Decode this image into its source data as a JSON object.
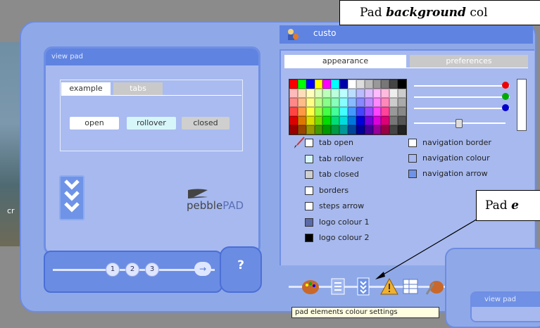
{
  "background_caption": "cr",
  "view_pad": {
    "header": "view pad",
    "tabs": [
      "example",
      "tabs"
    ],
    "buttons": {
      "open": "open",
      "rollover": "rollover",
      "closed": "closed"
    },
    "brand": {
      "part1": "pebble",
      "part2": "PAD"
    }
  },
  "stepper": {
    "steps": [
      "1",
      "2",
      "3"
    ],
    "next_symbol": "→",
    "help": "?"
  },
  "right_panel": {
    "title": "custo",
    "tabs": {
      "appearance": "appearance",
      "preferences": "preferences"
    },
    "options_left": [
      {
        "label": "tab open",
        "color": "#ffffff"
      },
      {
        "label": "tab rollover",
        "color": "#d7f6fa"
      },
      {
        "label": "tab closed",
        "color": "#cfcfcf"
      },
      {
        "label": "borders",
        "color": "#ffffff"
      },
      {
        "label": "steps arrow",
        "color": "#ffffff"
      },
      {
        "label": "logo colour 1",
        "color": "#5b6aa8"
      },
      {
        "label": "logo colour 2",
        "color": "#000000"
      }
    ],
    "options_right": [
      {
        "label": "navigation border",
        "color": "#ffffff"
      },
      {
        "label": "navigation colour",
        "color": "#a7b9ef"
      },
      {
        "label": "navigation arrow",
        "color": "#6f93e7"
      }
    ],
    "slider_colors": {
      "red": "#e00000",
      "green": "#00aa00",
      "blue": "#0000cc"
    }
  },
  "toolbar": {
    "tooltip": "pad elements colour settings"
  },
  "preview_window": {
    "header": "view pad"
  },
  "annotations": {
    "background": {
      "prefix": "Pad ",
      "emph": "background",
      "suffix": " col"
    },
    "elements": {
      "prefix": "Pad ",
      "emph": "e"
    }
  }
}
